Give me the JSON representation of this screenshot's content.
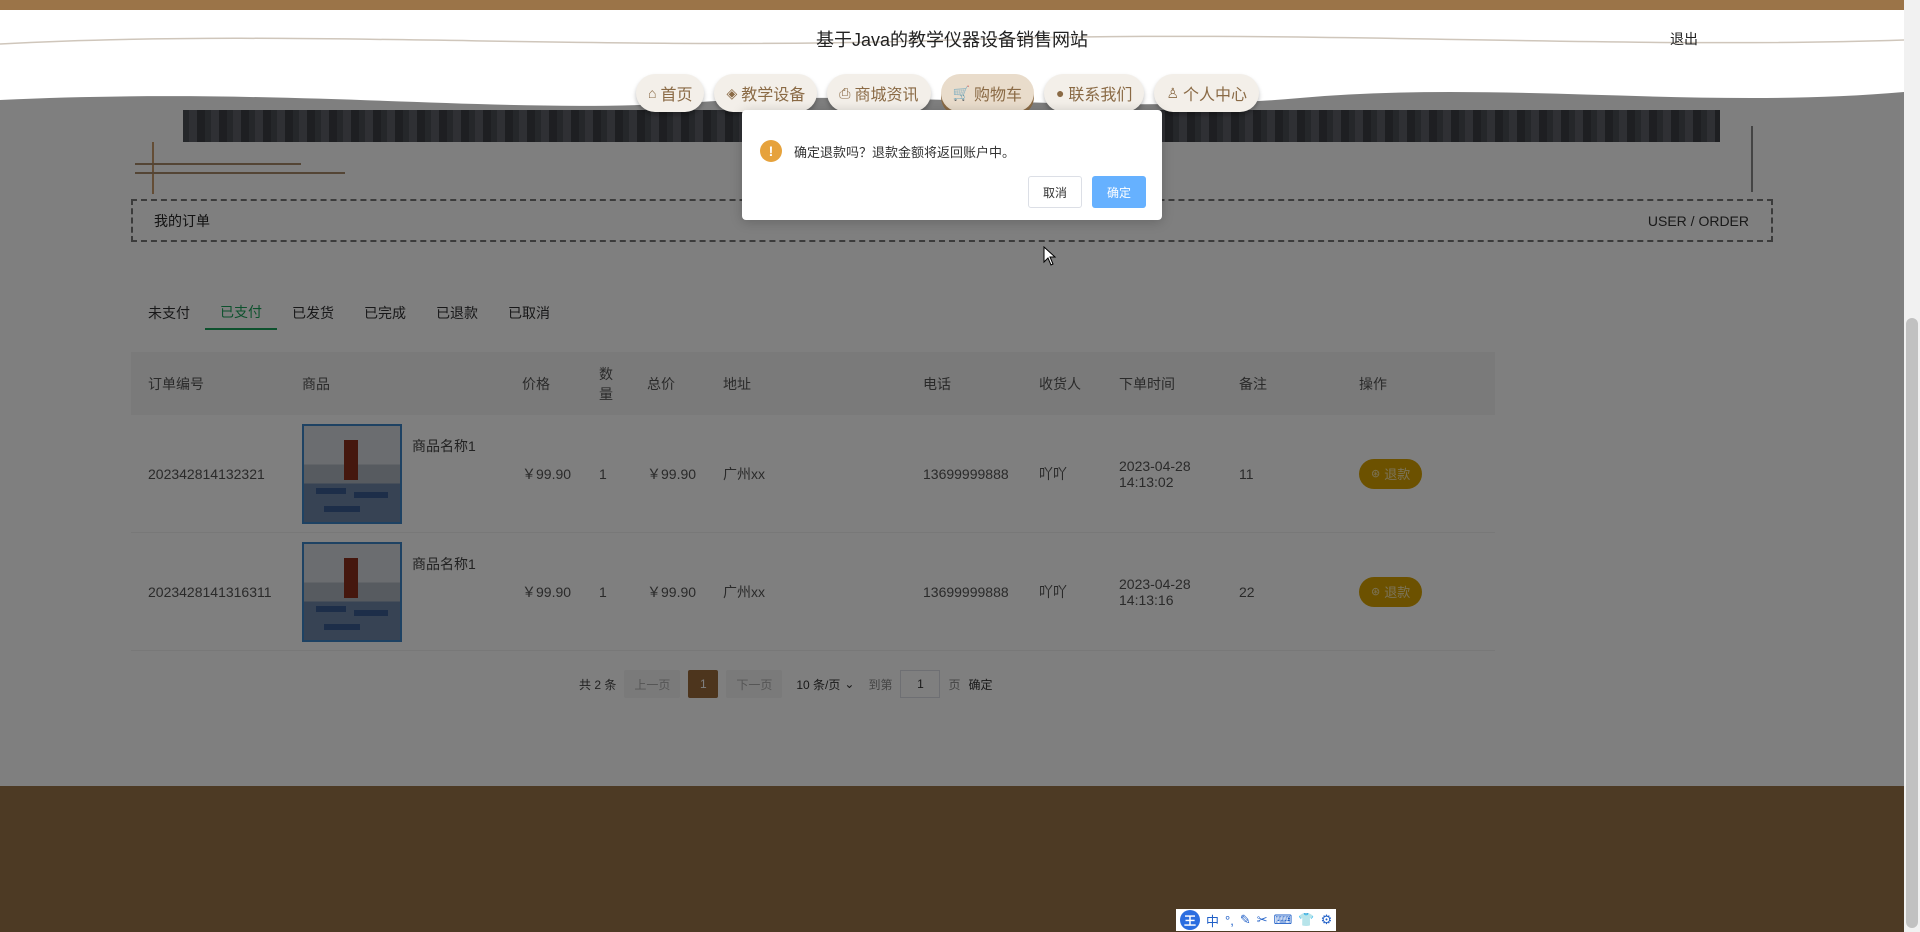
{
  "header": {
    "site_title": "基于Java的教学仪器设备销售网站",
    "logout": "退出"
  },
  "nav": [
    {
      "label": "首页",
      "icon": "home-icon"
    },
    {
      "label": "教学设备",
      "icon": "layers-icon"
    },
    {
      "label": "商城资讯",
      "icon": "printer-icon"
    },
    {
      "label": "购物车",
      "icon": "cart-icon",
      "active": true
    },
    {
      "label": "联系我们",
      "icon": "chat-icon"
    },
    {
      "label": "个人中心",
      "icon": "user-icon"
    }
  ],
  "section": {
    "title": "我的订单",
    "subtitle": "USER / ORDER"
  },
  "tabs": [
    "未支付",
    "已支付",
    "已发货",
    "已完成",
    "已退款",
    "已取消"
  ],
  "active_tab": "已支付",
  "table": {
    "headers": {
      "order_no": "订单编号",
      "goods": "商品",
      "price": "价格",
      "qty": "数量",
      "total": "总价",
      "address": "地址",
      "phone": "电话",
      "receiver": "收货人",
      "time": "下单时间",
      "note": "备注",
      "action": "操作"
    },
    "rows": [
      {
        "order_no": "202342814132321",
        "goods_name": "商品名称1",
        "price": "￥99.90",
        "qty": "1",
        "total": "￥99.90",
        "address": "广州xx",
        "phone": "13699999888",
        "receiver": "吖吖",
        "date": "2023-04-28",
        "time": "14:13:02",
        "note": "11",
        "action": "退款"
      },
      {
        "order_no": "2023428141316311",
        "goods_name": "商品名称1",
        "price": "￥99.90",
        "qty": "1",
        "total": "￥99.90",
        "address": "广州xx",
        "phone": "13699999888",
        "receiver": "吖吖",
        "date": "2023-04-28",
        "time": "14:13:16",
        "note": "22",
        "action": "退款"
      }
    ]
  },
  "pager": {
    "total": "共 2 条",
    "prev": "上一页",
    "current": "1",
    "next": "下一页",
    "page_size": "10 条/页",
    "goto": "到第",
    "goto_value": "1",
    "page_unit": "页",
    "confirm": "确定"
  },
  "dialog": {
    "message": "确定退款吗？退款金额将返回账户中。",
    "cancel": "取消",
    "ok": "确定"
  },
  "ime": {
    "logo": "王",
    "mode": "中"
  },
  "colors": {
    "brand": "#9b7448",
    "accent_green": "#1aa35b",
    "refund": "#d9a300",
    "ok_button": "#66b1ff"
  }
}
